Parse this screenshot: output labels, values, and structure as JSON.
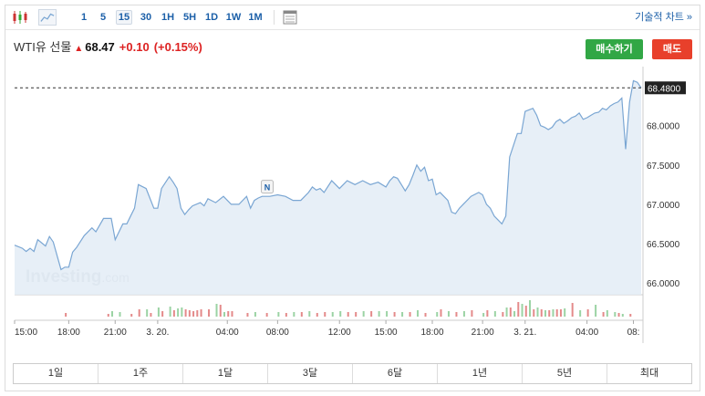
{
  "toolbar": {
    "timeframes": [
      "1",
      "5",
      "15",
      "30",
      "1H",
      "5H",
      "1D",
      "1W",
      "1M"
    ],
    "active_timeframe": "15",
    "technical_chart_label": "기술적 차트 »",
    "icons": [
      "candlestick-icon",
      "area-chart-icon",
      "calendar-icon"
    ]
  },
  "quote": {
    "name": "WTI유 선물",
    "price": "68.47",
    "change": "+0.10",
    "change_pct": "(+0.15%)",
    "direction": "up"
  },
  "actions": {
    "buy_label": "매수하기",
    "sell_label": "매도"
  },
  "watermark": {
    "brand": "Investing",
    "suffix": ".com"
  },
  "marker_label": "N",
  "range_tabs": [
    "1일",
    "1주",
    "1달",
    "3달",
    "6달",
    "1년",
    "5년",
    "최대"
  ],
  "colors": {
    "line": "#7aa6d3",
    "fill": "#e3ecf6",
    "up_volume": "#9bd3a4",
    "down_volume": "#e48a8a",
    "buy": "#31a745",
    "sell": "#e8402b",
    "price_tag": "#222222"
  },
  "chart_data": {
    "type": "area",
    "x_tick_labels": [
      "15:00",
      "18:00",
      "21:00",
      "3. 20.",
      "04:00",
      "08:00",
      "12:00",
      "15:00",
      "18:00",
      "21:00",
      "3. 21.",
      "04:00",
      "08:"
    ],
    "y_tick_labels": [
      "68.0000",
      "67.5000",
      "67.0000",
      "66.5000",
      "66.0000"
    ],
    "ylim": [
      65.85,
      68.75
    ],
    "grid": false,
    "last_price": 68.48,
    "last_price_label": "68.4800",
    "marker": {
      "label": "N",
      "x": 65.2
    },
    "x": [
      0,
      2,
      3,
      4,
      5,
      6,
      8,
      9,
      10,
      12,
      13,
      14,
      15,
      16,
      18,
      20,
      21,
      23,
      25,
      26,
      28,
      29,
      30,
      31,
      32,
      34,
      36,
      37,
      38,
      40,
      41,
      42,
      43,
      44,
      45,
      46,
      48,
      49,
      50,
      52,
      54,
      56,
      58,
      60,
      61,
      62,
      63,
      64,
      65,
      66,
      68,
      70,
      72,
      74,
      76,
      77,
      78,
      79,
      80,
      82,
      84,
      86,
      88,
      90,
      92,
      94,
      96,
      97,
      98,
      99,
      100,
      101,
      102,
      103,
      104,
      105,
      106,
      107,
      108,
      109,
      110,
      112,
      113,
      114,
      115,
      116,
      118,
      120,
      121,
      122,
      123,
      124,
      125,
      126,
      127,
      128,
      130,
      131,
      132,
      134,
      135,
      136,
      137,
      138,
      139,
      140,
      141,
      142,
      143,
      144,
      145,
      146,
      147,
      148,
      149,
      150,
      151,
      152,
      153,
      154,
      155,
      156,
      157,
      158,
      159,
      160,
      161,
      162
    ],
    "y": [
      66.48,
      66.44,
      66.4,
      66.44,
      66.4,
      66.55,
      66.47,
      66.59,
      66.52,
      66.17,
      66.2,
      66.2,
      66.39,
      66.45,
      66.6,
      66.7,
      66.65,
      66.82,
      66.82,
      66.55,
      66.75,
      66.75,
      66.85,
      66.95,
      67.25,
      67.2,
      66.95,
      66.95,
      67.2,
      67.35,
      67.28,
      67.2,
      66.95,
      66.87,
      66.93,
      66.98,
      67.02,
      66.98,
      67.07,
      67.02,
      67.1,
      67.0,
      67.0,
      67.1,
      66.95,
      67.05,
      67.08,
      67.1,
      67.1,
      67.1,
      67.12,
      67.1,
      67.05,
      67.05,
      67.15,
      67.22,
      67.18,
      67.2,
      67.15,
      67.3,
      67.2,
      67.3,
      67.25,
      67.3,
      67.25,
      67.28,
      67.22,
      67.3,
      67.35,
      67.33,
      67.25,
      67.17,
      67.25,
      67.37,
      67.5,
      67.42,
      67.47,
      67.3,
      67.32,
      67.12,
      67.15,
      67.05,
      66.9,
      66.88,
      66.95,
      67.0,
      67.1,
      67.15,
      67.12,
      67.0,
      66.95,
      66.85,
      66.8,
      66.75,
      66.85,
      67.6,
      67.9,
      67.9,
      68.18,
      68.22,
      68.13,
      68.0,
      67.98,
      67.95,
      67.98,
      68.05,
      68.08,
      68.03,
      68.06,
      68.1,
      68.12,
      68.16,
      68.08,
      68.1,
      68.13,
      68.16,
      68.17,
      68.22,
      68.2,
      68.25,
      68.28,
      68.3,
      68.35,
      67.7,
      68.3,
      68.57,
      68.55,
      68.48
    ],
    "volume_up": [
      [
        25,
        6
      ],
      [
        27,
        5
      ],
      [
        34,
        8
      ],
      [
        37,
        10
      ],
      [
        40,
        11
      ],
      [
        42,
        9
      ],
      [
        43,
        10
      ],
      [
        52,
        14
      ],
      [
        54,
        5
      ],
      [
        62,
        5
      ],
      [
        68,
        5
      ],
      [
        72,
        5
      ],
      [
        76,
        6
      ],
      [
        82,
        5
      ],
      [
        84,
        6
      ],
      [
        90,
        6
      ],
      [
        94,
        6
      ],
      [
        96,
        6
      ],
      [
        100,
        5
      ],
      [
        104,
        7
      ],
      [
        109,
        5
      ],
      [
        112,
        6
      ],
      [
        116,
        6
      ],
      [
        121,
        4
      ],
      [
        124,
        6
      ],
      [
        127,
        10
      ],
      [
        129,
        6
      ],
      [
        131,
        14
      ],
      [
        133,
        18
      ],
      [
        135,
        10
      ],
      [
        137,
        7
      ],
      [
        139,
        8
      ],
      [
        142,
        9
      ],
      [
        146,
        7
      ],
      [
        150,
        13
      ],
      [
        153,
        7
      ],
      [
        155,
        5
      ],
      [
        157,
        3
      ]
    ],
    "volume_down": [
      [
        13,
        4
      ],
      [
        24,
        3
      ],
      [
        30,
        3
      ],
      [
        32,
        8
      ],
      [
        35,
        4
      ],
      [
        38,
        6
      ],
      [
        41,
        7
      ],
      [
        44,
        8
      ],
      [
        45,
        7
      ],
      [
        46,
        6
      ],
      [
        47,
        7
      ],
      [
        48,
        8
      ],
      [
        50,
        8
      ],
      [
        53,
        13
      ],
      [
        55,
        6
      ],
      [
        56,
        6
      ],
      [
        60,
        4
      ],
      [
        65,
        4
      ],
      [
        70,
        4
      ],
      [
        74,
        5
      ],
      [
        78,
        4
      ],
      [
        80,
        5
      ],
      [
        86,
        5
      ],
      [
        88,
        5
      ],
      [
        92,
        6
      ],
      [
        98,
        5
      ],
      [
        102,
        5
      ],
      [
        106,
        4
      ],
      [
        110,
        8
      ],
      [
        114,
        5
      ],
      [
        118,
        7
      ],
      [
        122,
        7
      ],
      [
        126,
        5
      ],
      [
        128,
        10
      ],
      [
        130,
        16
      ],
      [
        132,
        12
      ],
      [
        134,
        8
      ],
      [
        136,
        8
      ],
      [
        138,
        7
      ],
      [
        140,
        8
      ],
      [
        141,
        8
      ],
      [
        144,
        15
      ],
      [
        148,
        8
      ],
      [
        152,
        5
      ],
      [
        156,
        4
      ],
      [
        159,
        3
      ]
    ]
  }
}
